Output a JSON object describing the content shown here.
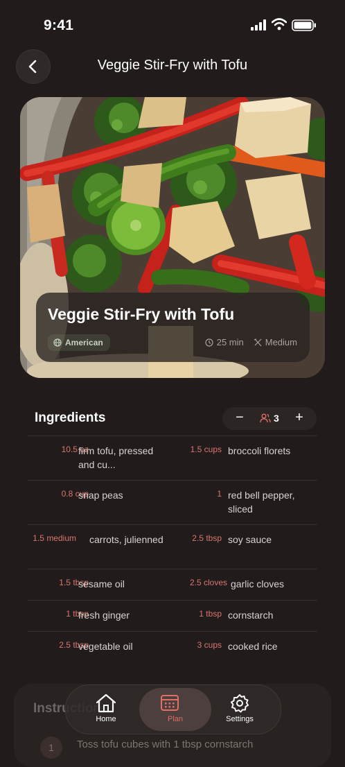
{
  "status_bar": {
    "time": "9:41"
  },
  "header": {
    "title": "Veggie Stir-Fry with Tofu",
    "back_icon": "chevron-left-icon"
  },
  "hero": {
    "title": "Veggie Stir-Fry with Tofu",
    "cuisine": "American",
    "time": "25 min",
    "difficulty": "Medium"
  },
  "ingredients": {
    "title": "Ingredients",
    "servings": "3",
    "items": [
      {
        "qty": "10.5 oz",
        "name": "firm tofu, pressed and cu..."
      },
      {
        "qty": "1.5 cups",
        "name": "broccoli florets"
      },
      {
        "qty": "0.8 cup",
        "name": "snap peas"
      },
      {
        "qty": "1",
        "name": "red bell pepper, sliced"
      },
      {
        "qty": "1.5 medium",
        "name": "carrots, julienned"
      },
      {
        "qty": "2.5 tbsp",
        "name": "soy sauce"
      },
      {
        "qty": "1.5 tbsp",
        "name": "sesame oil"
      },
      {
        "qty": "2.5 cloves",
        "name": "garlic cloves"
      },
      {
        "qty": "1 tbsp",
        "name": "fresh ginger"
      },
      {
        "qty": "1 tbsp",
        "name": "cornstarch"
      },
      {
        "qty": "2.5 tbsp",
        "name": "vegetable oil"
      },
      {
        "qty": "3 cups",
        "name": "cooked rice"
      }
    ]
  },
  "instructions": {
    "title": "Instructions",
    "first_step_number": "1",
    "first_step": "Toss tofu cubes with 1 tbsp cornstarch"
  },
  "tabbar": {
    "tabs": [
      {
        "label": "Home",
        "icon": "home-icon"
      },
      {
        "label": "Plan",
        "icon": "calendar-icon",
        "active": true
      },
      {
        "label": "Settings",
        "icon": "gear-icon"
      }
    ]
  },
  "colors": {
    "accent": "#e06f68",
    "background": "#211c1b"
  }
}
